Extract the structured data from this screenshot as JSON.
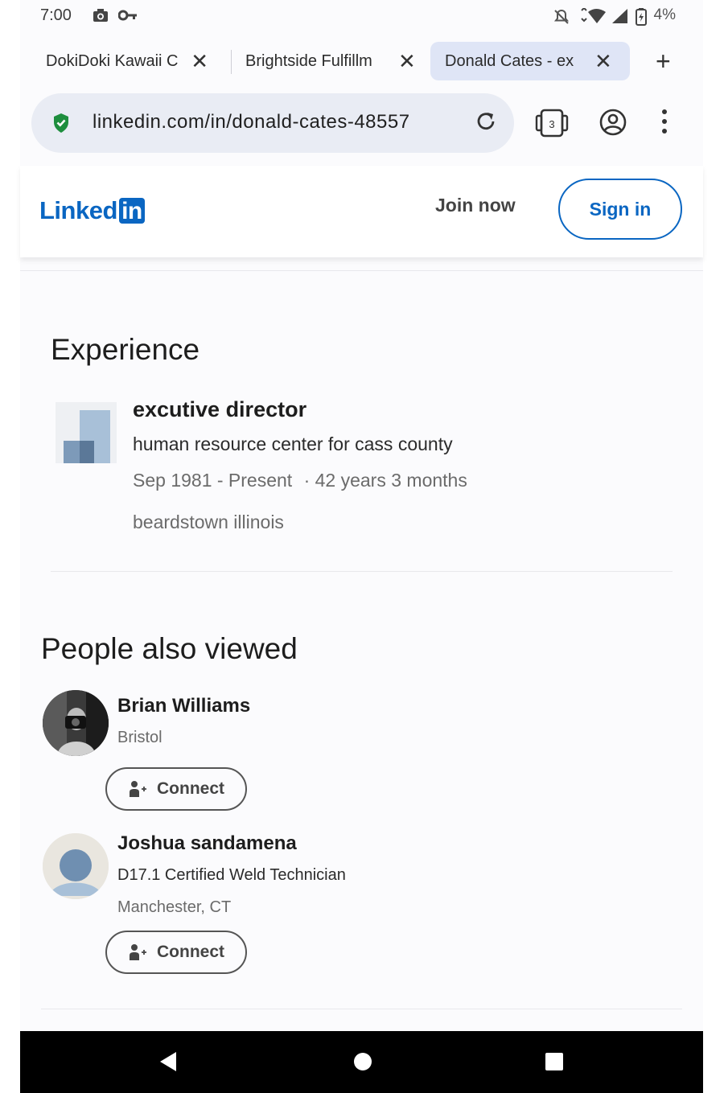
{
  "status_bar": {
    "time": "7:00",
    "battery": "4%"
  },
  "tabs": [
    {
      "title": "DokiDoki Kawaii C",
      "active": false
    },
    {
      "title": "Brightside Fulfillm",
      "active": false
    },
    {
      "title": "Donald Cates - ex",
      "active": true
    }
  ],
  "address_bar": {
    "url": "linkedin.com/in/donald-cates-48557",
    "tab_count": "3"
  },
  "header": {
    "logo_text": "Linked",
    "logo_in": "in",
    "join_label": "Join now",
    "signin_label": "Sign in"
  },
  "experience": {
    "heading": "Experience",
    "items": [
      {
        "title": "excutive director",
        "organization": "human resource center for cass county",
        "dates": "Sep 1981 - Present",
        "duration": "· 42 years 3 months",
        "location": "beardstown illinois"
      }
    ]
  },
  "people_also_viewed": {
    "heading": "People also viewed",
    "people": [
      {
        "name": "Brian Williams",
        "location": "Bristol",
        "headline": "",
        "connect_label": "Connect"
      },
      {
        "name": "Joshua sandamena",
        "headline": "D17.1 Certified Weld Technician",
        "location": "Manchester, CT",
        "connect_label": "Connect"
      }
    ]
  },
  "colors": {
    "brand": "#0a66c2",
    "active_tab": "#dfe5f6",
    "omnibox": "#e9ecf4",
    "shield_green": "#1e8e3e"
  }
}
